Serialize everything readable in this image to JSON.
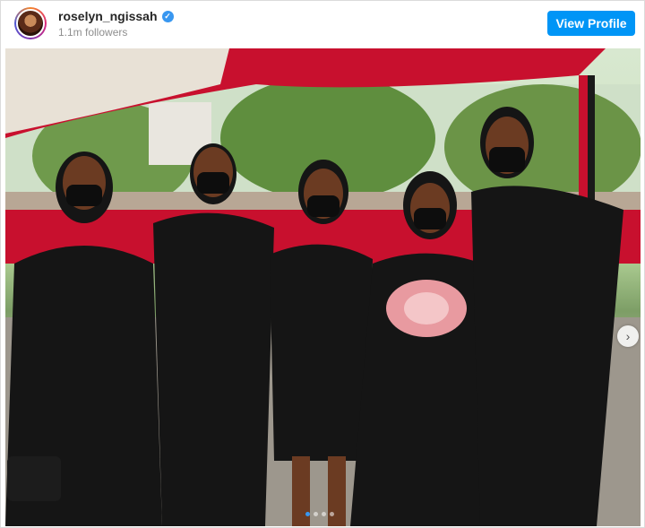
{
  "post": {
    "username": "roselyn_ngissah",
    "followers": "1.1m followers",
    "view_profile_label": "View Profile",
    "verified_glyph": "✓"
  },
  "carousel": {
    "total": 4,
    "active_index": 0,
    "next_glyph": "›"
  },
  "colors": {
    "tent_red": "#c8102e",
    "accent_blue": "#0095f6"
  }
}
